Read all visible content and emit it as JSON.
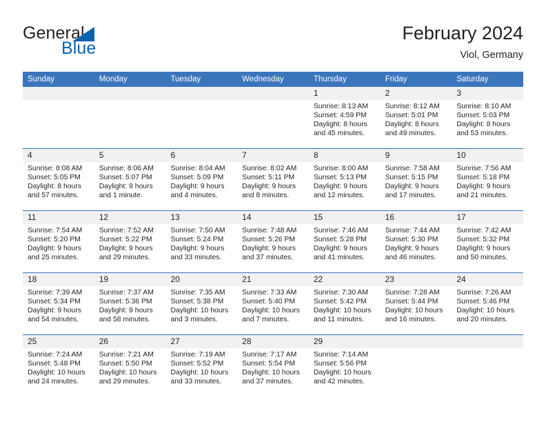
{
  "branding": {
    "name_part1": "General",
    "name_part2": "Blue",
    "triangle_color": "#0b63b0"
  },
  "header": {
    "title": "February 2024",
    "location": "Viol, Germany"
  },
  "colors": {
    "header_blue": "#3b76bc",
    "row_divider_blue": "#3b76bc",
    "number_band_gray": "#f1f1f1",
    "text": "#231f20",
    "logo_blue": "#0b63b0"
  },
  "calendar": {
    "weekdays": [
      "Sunday",
      "Monday",
      "Tuesday",
      "Wednesday",
      "Thursday",
      "Friday",
      "Saturday"
    ],
    "weeks": [
      {
        "days": [
          {
            "number": "",
            "lines": []
          },
          {
            "number": "",
            "lines": []
          },
          {
            "number": "",
            "lines": []
          },
          {
            "number": "",
            "lines": []
          },
          {
            "number": "1",
            "lines": [
              "Sunrise: 8:13 AM",
              "Sunset: 4:59 PM",
              "Daylight: 8 hours",
              "and 45 minutes."
            ]
          },
          {
            "number": "2",
            "lines": [
              "Sunrise: 8:12 AM",
              "Sunset: 5:01 PM",
              "Daylight: 8 hours",
              "and 49 minutes."
            ]
          },
          {
            "number": "3",
            "lines": [
              "Sunrise: 8:10 AM",
              "Sunset: 5:03 PM",
              "Daylight: 8 hours",
              "and 53 minutes."
            ]
          }
        ]
      },
      {
        "days": [
          {
            "number": "4",
            "lines": [
              "Sunrise: 8:08 AM",
              "Sunset: 5:05 PM",
              "Daylight: 8 hours",
              "and 57 minutes."
            ]
          },
          {
            "number": "5",
            "lines": [
              "Sunrise: 8:06 AM",
              "Sunset: 5:07 PM",
              "Daylight: 9 hours",
              "and 1 minute."
            ]
          },
          {
            "number": "6",
            "lines": [
              "Sunrise: 8:04 AM",
              "Sunset: 5:09 PM",
              "Daylight: 9 hours",
              "and 4 minutes."
            ]
          },
          {
            "number": "7",
            "lines": [
              "Sunrise: 8:02 AM",
              "Sunset: 5:11 PM",
              "Daylight: 9 hours",
              "and 8 minutes."
            ]
          },
          {
            "number": "8",
            "lines": [
              "Sunrise: 8:00 AM",
              "Sunset: 5:13 PM",
              "Daylight: 9 hours",
              "and 12 minutes."
            ]
          },
          {
            "number": "9",
            "lines": [
              "Sunrise: 7:58 AM",
              "Sunset: 5:15 PM",
              "Daylight: 9 hours",
              "and 17 minutes."
            ]
          },
          {
            "number": "10",
            "lines": [
              "Sunrise: 7:56 AM",
              "Sunset: 5:18 PM",
              "Daylight: 9 hours",
              "and 21 minutes."
            ]
          }
        ]
      },
      {
        "days": [
          {
            "number": "11",
            "lines": [
              "Sunrise: 7:54 AM",
              "Sunset: 5:20 PM",
              "Daylight: 9 hours",
              "and 25 minutes."
            ]
          },
          {
            "number": "12",
            "lines": [
              "Sunrise: 7:52 AM",
              "Sunset: 5:22 PM",
              "Daylight: 9 hours",
              "and 29 minutes."
            ]
          },
          {
            "number": "13",
            "lines": [
              "Sunrise: 7:50 AM",
              "Sunset: 5:24 PM",
              "Daylight: 9 hours",
              "and 33 minutes."
            ]
          },
          {
            "number": "14",
            "lines": [
              "Sunrise: 7:48 AM",
              "Sunset: 5:26 PM",
              "Daylight: 9 hours",
              "and 37 minutes."
            ]
          },
          {
            "number": "15",
            "lines": [
              "Sunrise: 7:46 AM",
              "Sunset: 5:28 PM",
              "Daylight: 9 hours",
              "and 41 minutes."
            ]
          },
          {
            "number": "16",
            "lines": [
              "Sunrise: 7:44 AM",
              "Sunset: 5:30 PM",
              "Daylight: 9 hours",
              "and 46 minutes."
            ]
          },
          {
            "number": "17",
            "lines": [
              "Sunrise: 7:42 AM",
              "Sunset: 5:32 PM",
              "Daylight: 9 hours",
              "and 50 minutes."
            ]
          }
        ]
      },
      {
        "days": [
          {
            "number": "18",
            "lines": [
              "Sunrise: 7:39 AM",
              "Sunset: 5:34 PM",
              "Daylight: 9 hours",
              "and 54 minutes."
            ]
          },
          {
            "number": "19",
            "lines": [
              "Sunrise: 7:37 AM",
              "Sunset: 5:36 PM",
              "Daylight: 9 hours",
              "and 58 minutes."
            ]
          },
          {
            "number": "20",
            "lines": [
              "Sunrise: 7:35 AM",
              "Sunset: 5:38 PM",
              "Daylight: 10 hours",
              "and 3 minutes."
            ]
          },
          {
            "number": "21",
            "lines": [
              "Sunrise: 7:33 AM",
              "Sunset: 5:40 PM",
              "Daylight: 10 hours",
              "and 7 minutes."
            ]
          },
          {
            "number": "22",
            "lines": [
              "Sunrise: 7:30 AM",
              "Sunset: 5:42 PM",
              "Daylight: 10 hours",
              "and 11 minutes."
            ]
          },
          {
            "number": "23",
            "lines": [
              "Sunrise: 7:28 AM",
              "Sunset: 5:44 PM",
              "Daylight: 10 hours",
              "and 16 minutes."
            ]
          },
          {
            "number": "24",
            "lines": [
              "Sunrise: 7:26 AM",
              "Sunset: 5:46 PM",
              "Daylight: 10 hours",
              "and 20 minutes."
            ]
          }
        ]
      },
      {
        "days": [
          {
            "number": "25",
            "lines": [
              "Sunrise: 7:24 AM",
              "Sunset: 5:48 PM",
              "Daylight: 10 hours",
              "and 24 minutes."
            ]
          },
          {
            "number": "26",
            "lines": [
              "Sunrise: 7:21 AM",
              "Sunset: 5:50 PM",
              "Daylight: 10 hours",
              "and 29 minutes."
            ]
          },
          {
            "number": "27",
            "lines": [
              "Sunrise: 7:19 AM",
              "Sunset: 5:52 PM",
              "Daylight: 10 hours",
              "and 33 minutes."
            ]
          },
          {
            "number": "28",
            "lines": [
              "Sunrise: 7:17 AM",
              "Sunset: 5:54 PM",
              "Daylight: 10 hours",
              "and 37 minutes."
            ]
          },
          {
            "number": "29",
            "lines": [
              "Sunrise: 7:14 AM",
              "Sunset: 5:56 PM",
              "Daylight: 10 hours",
              "and 42 minutes."
            ]
          },
          {
            "number": "",
            "lines": []
          },
          {
            "number": "",
            "lines": []
          }
        ]
      }
    ]
  }
}
